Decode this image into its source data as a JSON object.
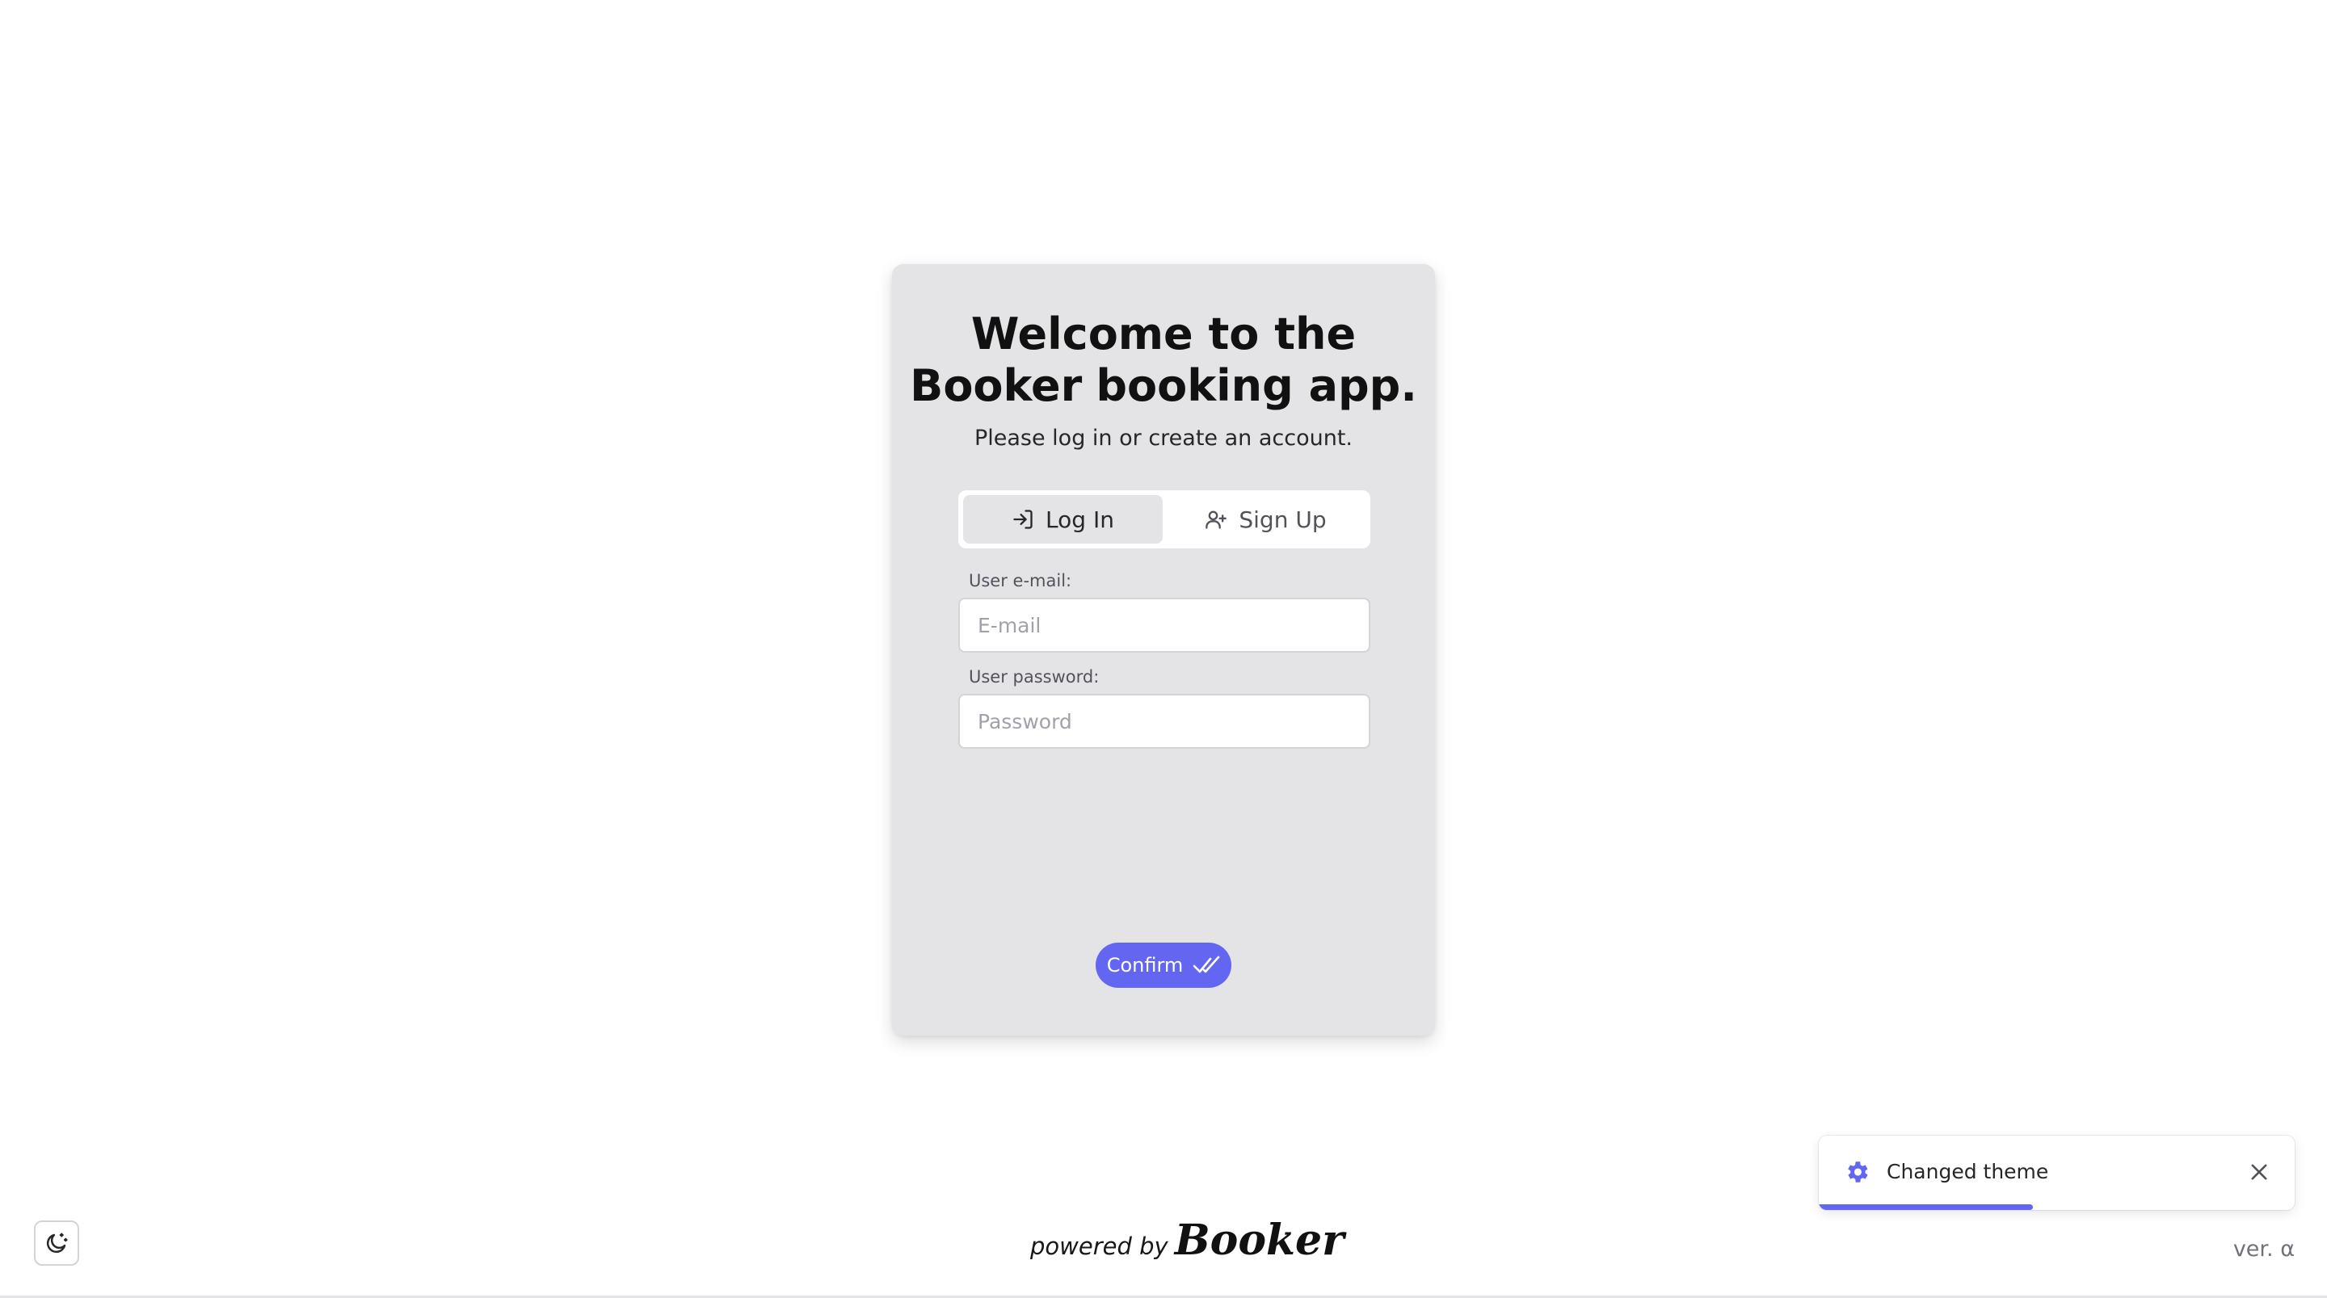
{
  "card": {
    "title_line1": "Welcome to the",
    "title_brand": "Booker",
    "title_rest": "booking app.",
    "subtitle": "Please log in or create an account."
  },
  "tabs": [
    {
      "label": "Log In",
      "icon": "login-icon",
      "active": true
    },
    {
      "label": "Sign Up",
      "icon": "user-plus-icon",
      "active": false
    }
  ],
  "form": {
    "email_label": "User e-mail:",
    "email_placeholder": "E-mail",
    "email_value": "",
    "password_label": "User password:",
    "password_placeholder": "Password",
    "password_value": ""
  },
  "confirm": {
    "label": "Confirm",
    "icon": "double-check-icon"
  },
  "footer": {
    "powered_prefix": "powered by",
    "brand": "Booker",
    "version": "ver. α"
  },
  "theme_toggle": {
    "icon": "moon-icon"
  },
  "toast": {
    "icon": "gear-icon",
    "message": "Changed theme",
    "close_icon": "close-icon",
    "progress": 0.45
  },
  "colors": {
    "accent": "#6366f1",
    "card_bg": "#e4e4e7",
    "page_bg": "#ffffff"
  }
}
